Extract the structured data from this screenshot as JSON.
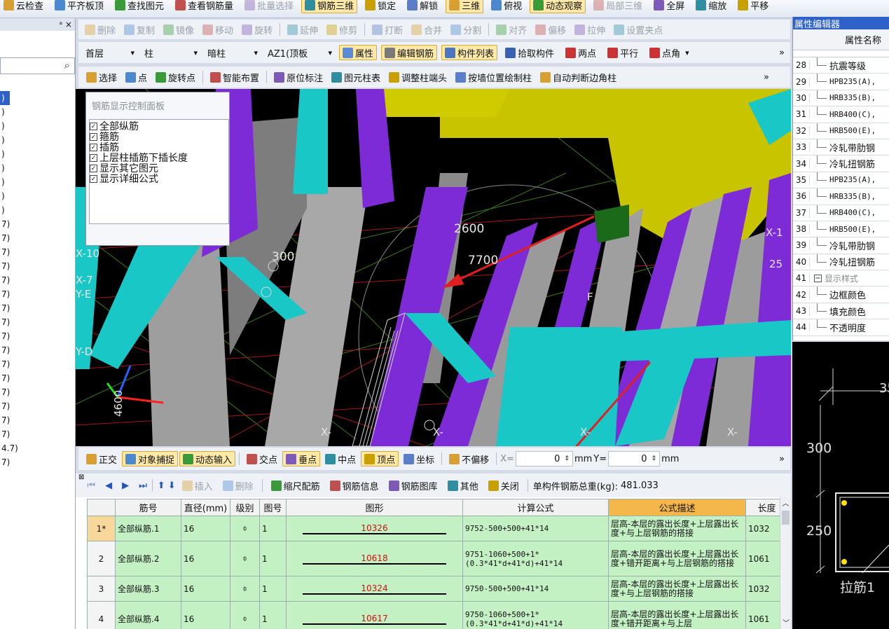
{
  "top_toolbar": {
    "items": [
      "云检查",
      "平齐板顶",
      "查找图元",
      "查看钢筋量",
      "批量选择",
      "钢筋三维",
      "锁定",
      "解锁",
      "三维",
      "俯视",
      "动态观察",
      "局部三维",
      "全屏",
      "缩放",
      "平移"
    ]
  },
  "left_panel": {
    "pin": "ᵃ ×",
    "items": [
      ")",
      ")",
      ")",
      ")",
      ")",
      ")",
      ")",
      ")",
      ")",
      "7)",
      "7)",
      "7)",
      "7)",
      "7)",
      "7)",
      "7)",
      "7)",
      "7)",
      "7)",
      "7)",
      "7)",
      "7)",
      "7)",
      "7)",
      "7)",
      "4.7)",
      "7)"
    ]
  },
  "edit_toolbar": {
    "items": [
      "删除",
      "复制",
      "镜像",
      "移动",
      "旋转",
      "延伸",
      "修剪",
      "打断",
      "合并",
      "分割",
      "对齐",
      "偏移",
      "拉伸",
      "设置夹点"
    ]
  },
  "selector_bar": {
    "floor": "首层",
    "type": "柱",
    "subtype": "暗柱",
    "element": "AZ1(顶板",
    "btn_attr": "属性",
    "btn_edit": "编辑钢筋",
    "btn_list": "构件列表",
    "btn_pick": "拾取构件",
    "btn_two": "两点",
    "btn_parallel": "平行",
    "btn_corner": "点角",
    "more": "»"
  },
  "draw_bar": {
    "items": [
      "选择",
      "点",
      "旋转点",
      "智能布置",
      "原位标注",
      "图元柱表",
      "调整柱端头",
      "按墙位置绘制柱",
      "自动判断边角柱"
    ],
    "more": "»"
  },
  "control_panel": {
    "title": "钢筋显示控制面板",
    "options": [
      "全部纵筋",
      "箍筋",
      "插筋",
      "上层柱插筋下插长度",
      "显示其它图元",
      "显示详细公式"
    ]
  },
  "viewport": {
    "labels": [
      "2600",
      "7700",
      "300",
      "X-10",
      "X-7",
      "Y-E",
      "Y-D",
      "X-",
      "X-",
      "X-",
      "X-1",
      "25",
      "X-",
      "4600",
      "F"
    ]
  },
  "snap_bar": {
    "items": [
      "正交",
      "对象捕捉",
      "动态输入",
      "交点",
      "垂点",
      "中点",
      "顶点",
      "坐标",
      "不偏移"
    ],
    "x_label": "X=",
    "x_value": "0",
    "mm1": "mm",
    "y_label": "Y=",
    "y_value": "0",
    "mm2": "mm",
    "more": "»"
  },
  "table_toolbar": {
    "items": [
      "插入",
      "删除",
      "缩尺配筋",
      "钢筋信息",
      "钢筋图库",
      "其他",
      "关闭"
    ],
    "total_label": "单构件钢筋总重(kg):",
    "total_value": "481.033"
  },
  "table": {
    "headers": [
      "筋号",
      "直径(mm)",
      "级别",
      "图号",
      "图形",
      "计算公式",
      "公式描述",
      "长度"
    ],
    "rows": [
      {
        "idx": "1*",
        "name": "全部纵筋.1",
        "dia": "16",
        "grade": "⌽",
        "fig": "1",
        "shape": "10326",
        "formula": "9752-500+500+41*14",
        "desc": "层高-本层的露出长度+上层露出长度+与上层钢筋的搭接",
        "len": "1032"
      },
      {
        "idx": "2",
        "name": "全部纵筋.2",
        "dia": "16",
        "grade": "⌽",
        "fig": "1",
        "shape": "10618",
        "formula": "9751-1060+500+1*(0.3*41*d+41*d)+41*14",
        "desc": "层高-本层的露出长度+上层露出长度+错开距离+与上层钢筋的搭接",
        "len": "1061"
      },
      {
        "idx": "3",
        "name": "全部纵筋.3",
        "dia": "16",
        "grade": "⌽",
        "fig": "1",
        "shape": "10324",
        "formula": "9750-500+500+41*14",
        "desc": "层高-本层的露出长度+上层露出长度+与上层钢筋的搭接",
        "len": "1032"
      },
      {
        "idx": "4",
        "name": "全部纵筋.4",
        "dia": "16",
        "grade": "⌽",
        "fig": "1",
        "shape": "10617",
        "formula": "9750-1060+500+1*(0.3*41*d+41*d)+41*14",
        "desc": "层高-本层的露出长度+上层露出长度+错开距离+与上层",
        "len": "1061"
      }
    ]
  },
  "property_editor": {
    "title": "属性编辑器",
    "header": "属性名称",
    "rows": [
      {
        "n": "28",
        "label": "抗震等级"
      },
      {
        "n": "29",
        "label": "HPB235(A),"
      },
      {
        "n": "30",
        "label": "HRB335(B),"
      },
      {
        "n": "31",
        "label": "HRB400(C),"
      },
      {
        "n": "32",
        "label": "HRB500(E),"
      },
      {
        "n": "33",
        "label": "冷轧带肋钢"
      },
      {
        "n": "34",
        "label": "冷轧扭钢筋"
      },
      {
        "n": "35",
        "label": "HPB235(A),"
      },
      {
        "n": "36",
        "label": "HRB335(B),"
      },
      {
        "n": "37",
        "label": "HRB400(C),"
      },
      {
        "n": "38",
        "label": "HRB500(E),"
      },
      {
        "n": "39",
        "label": "冷轧带肋钢"
      },
      {
        "n": "40",
        "label": "冷轧扭钢筋"
      },
      {
        "n": "41",
        "label": "显示样式"
      },
      {
        "n": "42",
        "label": "边框颜色"
      },
      {
        "n": "43",
        "label": "填充颜色"
      },
      {
        "n": "44",
        "label": "不透明度"
      }
    ]
  },
  "preview": {
    "dim_top": "35",
    "dim_300": "300",
    "dim_250": "250",
    "label": "拉筋1"
  }
}
